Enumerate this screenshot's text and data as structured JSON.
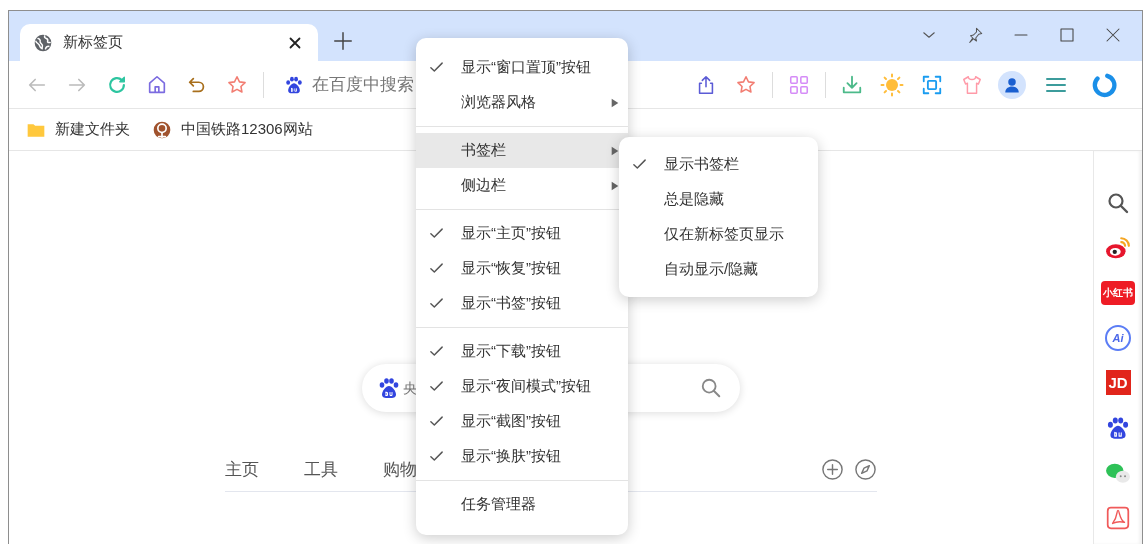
{
  "window": {
    "tab": {
      "title": "新标签页",
      "selected": true
    }
  },
  "toolbar": {
    "address_placeholder": "在百度中搜索"
  },
  "bookmarks": [
    {
      "label": "新建文件夹",
      "kind": "folder"
    },
    {
      "label": "中国铁路12306网站",
      "kind": "site"
    }
  ],
  "search": {
    "placeholder": "央"
  },
  "nav_tabs": [
    {
      "label": "主页"
    },
    {
      "label": "工具"
    },
    {
      "label": "购物"
    }
  ],
  "sidebar": [
    {
      "kind": "search"
    },
    {
      "kind": "eye"
    },
    {
      "kind": "badge",
      "text": "小红书"
    },
    {
      "kind": "ring",
      "text": "Ai"
    },
    {
      "kind": "block",
      "text": "JD"
    },
    {
      "kind": "paw"
    },
    {
      "kind": "chat"
    },
    {
      "kind": "doc"
    }
  ],
  "context_menu": {
    "groups": [
      {
        "items": [
          {
            "label": "显示“窗口置顶”按钮",
            "checked": true,
            "has_submenu": false,
            "highlighted": false
          },
          {
            "label": "浏览器风格",
            "checked": false,
            "has_submenu": true,
            "highlighted": false
          }
        ]
      },
      {
        "items": [
          {
            "label": "书签栏",
            "checked": false,
            "has_submenu": true,
            "highlighted": true
          },
          {
            "label": "侧边栏",
            "checked": false,
            "has_submenu": true,
            "highlighted": false
          }
        ]
      },
      {
        "items": [
          {
            "label": "显示“主页”按钮",
            "checked": true,
            "has_submenu": false,
            "highlighted": false
          },
          {
            "label": "显示“恢复”按钮",
            "checked": true,
            "has_submenu": false,
            "highlighted": false
          },
          {
            "label": "显示“书签”按钮",
            "checked": true,
            "has_submenu": false,
            "highlighted": false
          }
        ]
      },
      {
        "items": [
          {
            "label": "显示“下载”按钮",
            "checked": true,
            "has_submenu": false,
            "highlighted": false
          },
          {
            "label": "显示“夜间模式”按钮",
            "checked": true,
            "has_submenu": false,
            "highlighted": false
          },
          {
            "label": "显示“截图”按钮",
            "checked": true,
            "has_submenu": false,
            "highlighted": false
          },
          {
            "label": "显示“换肤”按钮",
            "checked": true,
            "has_submenu": false,
            "highlighted": false
          }
        ]
      },
      {
        "items": [
          {
            "label": "任务管理器",
            "checked": false,
            "has_submenu": false,
            "highlighted": false
          }
        ]
      }
    ]
  },
  "submenu": {
    "items": [
      {
        "label": "显示书签栏",
        "checked": true
      },
      {
        "label": "总是隐藏",
        "checked": false
      },
      {
        "label": "仅在新标签页显示",
        "checked": false
      },
      {
        "label": "自动显示/隐藏",
        "checked": false
      }
    ]
  }
}
